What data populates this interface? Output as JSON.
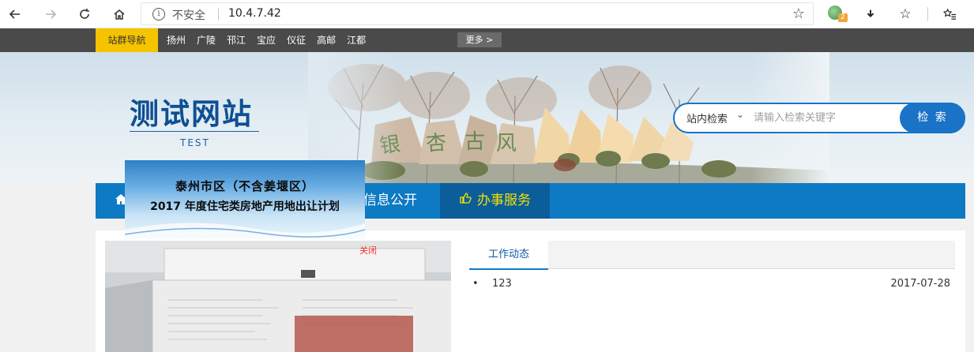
{
  "browser": {
    "security_label": "不安全",
    "url": "10.4.7.42",
    "extension_badge_count": "2"
  },
  "site_nav": {
    "station_label": "站群导航",
    "links": [
      "扬州",
      "广陵",
      "邗江",
      "宝应",
      "仪征",
      "高邮",
      "江都"
    ],
    "more_label": "更多 >"
  },
  "header": {
    "logo_title": "测试网站",
    "logo_subtitle": "TEST",
    "search": {
      "scope_label": "站内检索",
      "placeholder": "请输入检索关键字",
      "button_label": "检 索"
    }
  },
  "main_nav": {
    "items": [
      {
        "label": "信息公开"
      },
      {
        "label": "办事服务"
      }
    ]
  },
  "float_ad": {
    "line1": "泰州市区（不含姜堰区）",
    "line2": "2017 年度住宅类房地产用地出让计划",
    "close_label": "关闭"
  },
  "news": {
    "tab_label": "工作动态",
    "items": [
      {
        "bullet": "•",
        "title": "123",
        "date": "2017-07-28"
      }
    ]
  },
  "colors": {
    "nav_blue": "#0e7ac4",
    "active_nav_text": "#f5e200",
    "station_yellow": "#f5c300",
    "top_bar": "#4a4a4a"
  }
}
